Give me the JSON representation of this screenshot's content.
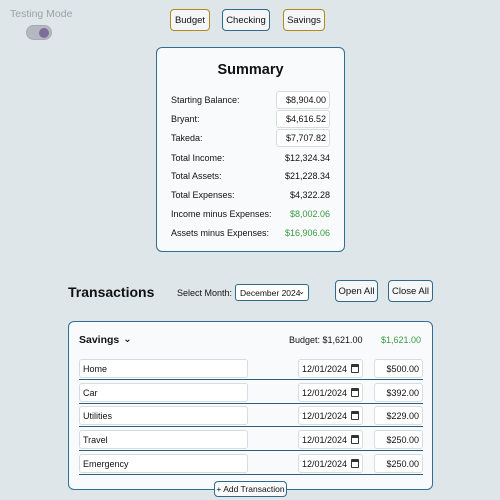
{
  "testing_mode": {
    "label": "Testing Mode",
    "enabled": true
  },
  "nav": {
    "budget": "Budget",
    "checking": "Checking",
    "savings": "Savings"
  },
  "summary": {
    "title": "Summary",
    "rows": [
      {
        "label": "Starting Balance:",
        "value": "$8,904.00"
      },
      {
        "label": "Bryant:",
        "value": "$4,616.52"
      },
      {
        "label": "Takeda:",
        "value": "$7,707.82"
      },
      {
        "label": "Total Income:",
        "value": "$12,324.34"
      },
      {
        "label": "Total Assets:",
        "value": "$21,228.34"
      },
      {
        "label": "Total Expenses:",
        "value": "$4,322.28"
      },
      {
        "label": "Income minus Expenses:",
        "value": "$8,002.06"
      },
      {
        "label": "Assets minus Expenses:",
        "value": "$16,906.06"
      }
    ]
  },
  "transactions": {
    "title": "Transactions",
    "select_month_label": "Select Month:",
    "selected_month": "December 2024",
    "open_all": "Open All",
    "close_all": "Close All",
    "add_transaction": "+ Add Transaction"
  },
  "savings": {
    "title": "Savings",
    "budget_text": "Budget: $1,621.00",
    "total": "$1,621.00",
    "items": [
      {
        "name": "Home",
        "date": "12/01/2024",
        "amount": "$500.00"
      },
      {
        "name": "Car",
        "date": "12/01/2024",
        "amount": "$392.00"
      },
      {
        "name": "Utilities",
        "date": "12/01/2024",
        "amount": "$229.00"
      },
      {
        "name": "Travel",
        "date": "12/01/2024",
        "amount": "$250.00"
      },
      {
        "name": "Emergency",
        "date": "12/01/2024",
        "amount": "$250.00"
      }
    ]
  },
  "colors": {
    "accent": "#2f6f93",
    "gold": "#b08a1c",
    "positive": "#3b9a44",
    "background": "#dfe6ea"
  }
}
